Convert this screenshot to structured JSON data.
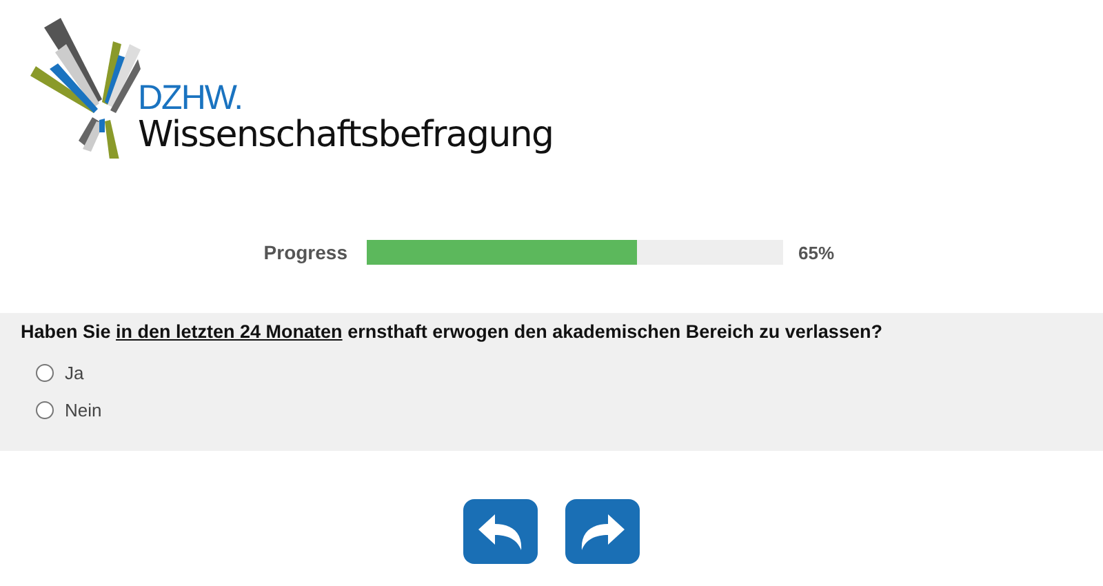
{
  "logo": {
    "acronym": "DZHW.",
    "name": "Wissenschaftsbefragung"
  },
  "progress": {
    "label": "Progress",
    "level": 0.65,
    "reading": "65%"
  },
  "question": {
    "text_before": "Haben Sie",
    "text_underlined": "in den letzten 24 Monaten",
    "text_after": "ernsthaft erwogen den akademischen Bereich zu verlassen?",
    "options": [
      {
        "label": "Ja",
        "selected": false
      },
      {
        "label": "Nein",
        "selected": false
      }
    ]
  },
  "navigation": [
    {
      "kind": "back"
    },
    {
      "kind": "next"
    }
  ]
}
